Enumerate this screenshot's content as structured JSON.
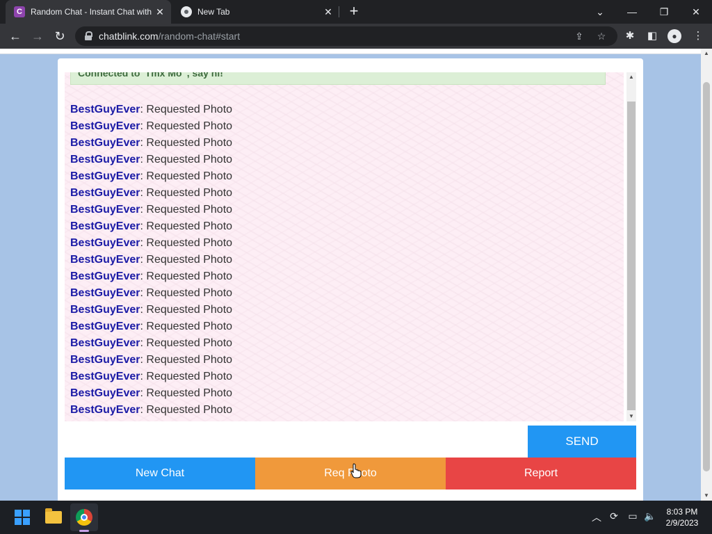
{
  "browser": {
    "tabs": [
      {
        "title": "Random Chat - Instant Chat with",
        "favicon": "chatblink-c-icon",
        "favicon_letter": "C",
        "active": true
      },
      {
        "title": "New Tab",
        "favicon": "chrome-icon",
        "active": false
      }
    ],
    "url_host": "chatblink.com",
    "url_path": "/random-chat#start"
  },
  "chat": {
    "status": "Connected to 'Tmx Mo' , say hi!",
    "messages": [
      {
        "user": "BestGuyEver",
        "text": ": Requested Photo"
      },
      {
        "user": "BestGuyEver",
        "text": ": Requested Photo"
      },
      {
        "user": "BestGuyEver",
        "text": ": Requested Photo"
      },
      {
        "user": "BestGuyEver",
        "text": ": Requested Photo"
      },
      {
        "user": "BestGuyEver",
        "text": ": Requested Photo"
      },
      {
        "user": "BestGuyEver",
        "text": ": Requested Photo"
      },
      {
        "user": "BestGuyEver",
        "text": ": Requested Photo"
      },
      {
        "user": "BestGuyEver",
        "text": ": Requested Photo"
      },
      {
        "user": "BestGuyEver",
        "text": ": Requested Photo"
      },
      {
        "user": "BestGuyEver",
        "text": ": Requested Photo"
      },
      {
        "user": "BestGuyEver",
        "text": ": Requested Photo"
      },
      {
        "user": "BestGuyEver",
        "text": ": Requested Photo"
      },
      {
        "user": "BestGuyEver",
        "text": ": Requested Photo"
      },
      {
        "user": "BestGuyEver",
        "text": ": Requested Photo"
      },
      {
        "user": "BestGuyEver",
        "text": ": Requested Photo"
      },
      {
        "user": "BestGuyEver",
        "text": ": Requested Photo"
      },
      {
        "user": "BestGuyEver",
        "text": ": Requested Photo"
      },
      {
        "user": "BestGuyEver",
        "text": ": Requested Photo"
      },
      {
        "user": "BestGuyEver",
        "text": ": Requested Photo"
      },
      {
        "user": "BestGuyEver",
        "text": ": Requested Photo"
      }
    ],
    "input_value": "",
    "send_label": "SEND",
    "buttons": {
      "new_chat": "New Chat",
      "req_photo": "Req Photo",
      "report": "Report"
    }
  },
  "taskbar": {
    "time": "8:03 PM",
    "date": "2/9/2023"
  },
  "colors": {
    "send": "#2196f3",
    "new_chat": "#2196f3",
    "req_photo": "#f0993b",
    "report": "#e84545",
    "username": "#1a1aa6"
  }
}
